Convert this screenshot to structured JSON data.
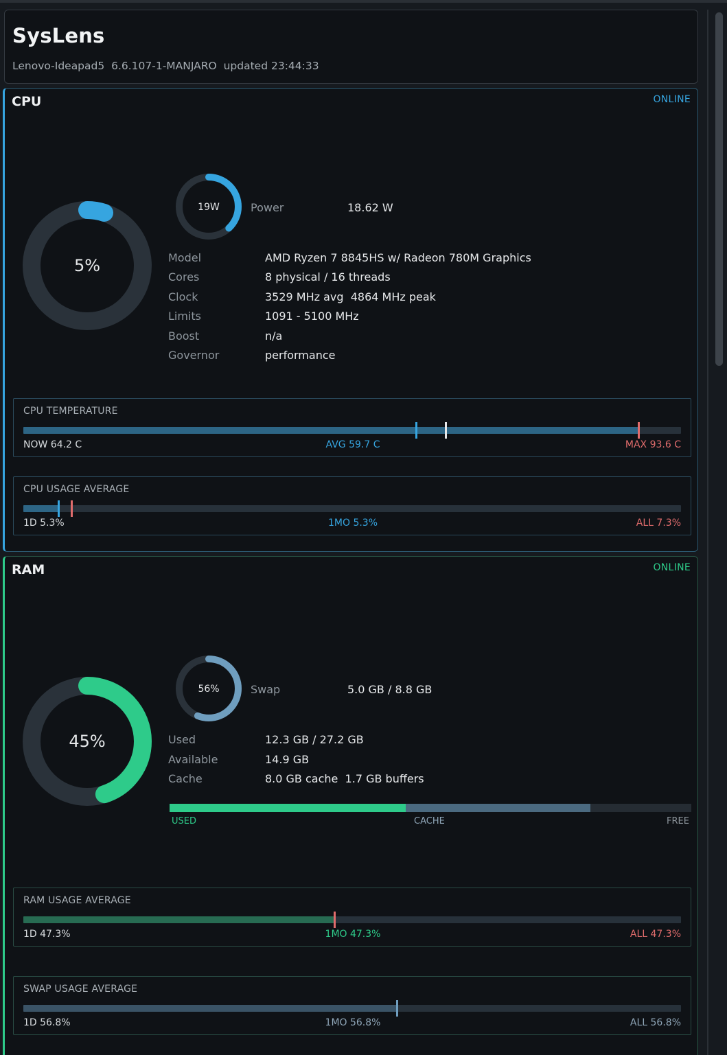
{
  "app": {
    "title": "SysLens",
    "subtitle": "Lenovo-Ideapad5  6.6.107-1-MANJARO  updated 23:44:33"
  },
  "colors": {
    "cpu_accent": "#36a5e0",
    "ram_accent": "#2ecb8a",
    "swap_accent": "#6f9ebf",
    "max_red": "#e06c6c",
    "track": "#2a323a"
  },
  "cpu": {
    "title": "CPU",
    "status": "ONLINE",
    "usage_label": "5%",
    "usage_fraction": 0.05,
    "power_ring_label": "19W",
    "power_fraction": 0.38,
    "power_label": "Power",
    "power_value": "18.62 W",
    "details": [
      {
        "label": "Model",
        "value": "AMD Ryzen 7 8845HS w/ Radeon 780M Graphics"
      },
      {
        "label": "Cores",
        "value": "8 physical / 16 threads"
      },
      {
        "label": "Clock",
        "value": "3529 MHz avg  4864 MHz peak"
      },
      {
        "label": "Limits",
        "value": "1091 - 5100 MHz"
      },
      {
        "label": "Boost",
        "value": "n/a"
      },
      {
        "label": "Governor",
        "value": "performance"
      }
    ],
    "temperature": {
      "title": "CPU TEMPERATURE",
      "now": "NOW 64.2 C",
      "avg": "AVG 59.7 C",
      "max": "MAX 93.6 C",
      "fill_fraction": 0.935,
      "avg_marker_fraction": 0.597,
      "now_marker_fraction": 0.642,
      "max_marker_fraction": 0.935
    },
    "usage_average": {
      "title": "CPU USAGE AVERAGE",
      "d1": "1D 5.3%",
      "mo1": "1MO 5.3%",
      "all": "ALL 7.3%",
      "fill_fraction": 0.053,
      "mo_marker_fraction": 0.053,
      "all_marker_fraction": 0.073
    }
  },
  "ram": {
    "title": "RAM",
    "status": "ONLINE",
    "usage_label": "45%",
    "usage_fraction": 0.45,
    "swap_ring_label": "56%",
    "swap_fraction": 0.56,
    "swap_label": "Swap",
    "swap_value": "5.0 GB / 8.8 GB",
    "details": [
      {
        "label": "Used",
        "value": "12.3 GB / 27.2 GB"
      },
      {
        "label": "Available",
        "value": "14.9 GB"
      },
      {
        "label": "Cache",
        "value": "8.0 GB cache  1.7 GB buffers"
      }
    ],
    "composition": {
      "used_label": "USED",
      "cache_label": "CACHE",
      "free_label": "FREE",
      "used_fraction": 0.453,
      "cache_fraction": 0.354
    },
    "usage_average": {
      "title": "RAM USAGE AVERAGE",
      "d1": "1D 47.3%",
      "mo1": "1MO 47.3%",
      "all": "ALL 47.3%",
      "fill_fraction": 0.473,
      "marker_fraction": 0.473
    },
    "swap_average": {
      "title": "SWAP USAGE AVERAGE",
      "d1": "1D 56.8%",
      "mo1": "1MO 56.8%",
      "all": "ALL 56.8%",
      "fill_fraction": 0.568,
      "marker_fraction": 0.568
    }
  }
}
